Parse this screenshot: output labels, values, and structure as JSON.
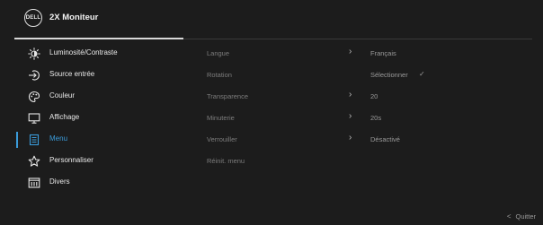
{
  "header": {
    "logo_text": "DELL",
    "title": "2X Moniteur"
  },
  "sidebar": {
    "items": [
      {
        "label": "Luminosité/Contraste",
        "icon": "brightness-icon"
      },
      {
        "label": "Source entrée",
        "icon": "input-source-icon"
      },
      {
        "label": "Couleur",
        "icon": "color-palette-icon"
      },
      {
        "label": "Affichage",
        "icon": "monitor-icon"
      },
      {
        "label": "Menu",
        "icon": "menu-list-icon",
        "active": true
      },
      {
        "label": "Personnaliser",
        "icon": "star-icon"
      },
      {
        "label": "Divers",
        "icon": "others-icon"
      }
    ]
  },
  "settings": {
    "rows": [
      {
        "name": "Langue",
        "value": "Français",
        "has_arrow": true
      },
      {
        "name": "Rotation",
        "value": "Sélectionner",
        "check": "✓",
        "has_arrow": false
      },
      {
        "name": "Transparence",
        "value": "20",
        "has_arrow": true
      },
      {
        "name": "Minuterie",
        "value": "20s",
        "has_arrow": true
      },
      {
        "name": "Verrouiller",
        "value": "Désactivé",
        "has_arrow": true
      },
      {
        "name": "Réinit. menu",
        "value": "",
        "has_arrow": false
      }
    ]
  },
  "footer": {
    "quit_label": "Quitter"
  },
  "colors": {
    "background": "#1c1c1c",
    "accent": "#3a9bd9",
    "muted_text": "#7d7d7d"
  }
}
